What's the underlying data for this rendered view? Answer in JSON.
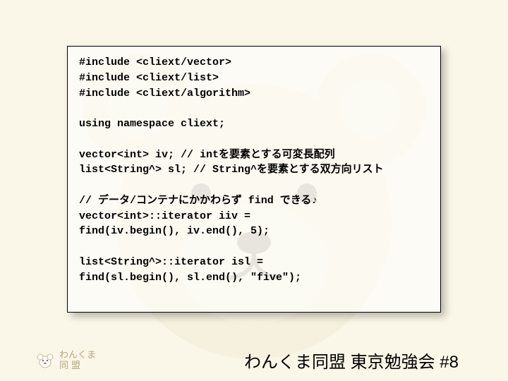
{
  "code": {
    "l1": "#include <cliext/vector>",
    "l2": "#include <cliext/list>",
    "l3": "#include <cliext/algorithm>",
    "l4": "",
    "l5": "using namespace cliext;",
    "l6": "",
    "l7": "vector<int> iv;  // intを要素とする可変長配列",
    "l8": "list<String^> sl; // String^を要素とする双方向リスト",
    "l9": "",
    "l10": "// データ/コンテナにかかわらず find できる♪",
    "l11": "vector<int>::iterator iiv =",
    "l12": "  find(iv.begin(), iv.end(), 5);",
    "l13": "",
    "l14": "list<String^>::iterator isl =",
    "l15": "  find(sl.begin(), sl.end(), \"five\");"
  },
  "logo": {
    "line1": "わんくま",
    "line2": "同盟"
  },
  "footer_title": "わんくま同盟 東京勉強会 #8"
}
